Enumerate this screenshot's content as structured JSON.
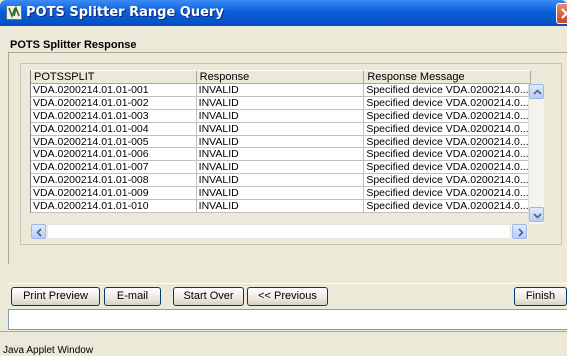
{
  "window": {
    "title": "POTS Splitter Range Query"
  },
  "section": {
    "title": "POTS Splitter Response"
  },
  "table": {
    "columns": [
      "POTSSPLIT",
      "Response",
      "Response Message"
    ],
    "rows": [
      [
        "VDA.0200214.01.01-001",
        "INVALID",
        "Specified device VDA.0200214.0..."
      ],
      [
        "VDA.0200214.01.01-002",
        "INVALID",
        "Specified device VDA.0200214.0..."
      ],
      [
        "VDA.0200214.01.01-003",
        "INVALID",
        "Specified device VDA.0200214.0..."
      ],
      [
        "VDA.0200214.01.01-004",
        "INVALID",
        "Specified device VDA.0200214.0..."
      ],
      [
        "VDA.0200214.01.01-005",
        "INVALID",
        "Specified device VDA.0200214.0..."
      ],
      [
        "VDA.0200214.01.01-006",
        "INVALID",
        "Specified device VDA.0200214.0..."
      ],
      [
        "VDA.0200214.01.01-007",
        "INVALID",
        "Specified device VDA.0200214.0..."
      ],
      [
        "VDA.0200214.01.01-008",
        "INVALID",
        "Specified device VDA.0200214.0..."
      ],
      [
        "VDA.0200214.01.01-009",
        "INVALID",
        "Specified device VDA.0200214.0..."
      ],
      [
        "VDA.0200214.01.01-010",
        "INVALID",
        "Specified device VDA.0200214.0..."
      ]
    ]
  },
  "buttons": {
    "print_preview": "Print Preview",
    "email": "E-mail",
    "start_over": "Start Over",
    "previous": "<< Previous",
    "finish": "Finish"
  },
  "footer": {
    "text": "Java Applet Window"
  },
  "icons": {
    "app": "java-applet-icon",
    "close": "close-icon",
    "scroll_up": "arrow-up-icon",
    "scroll_down": "arrow-down-icon",
    "scroll_left": "arrow-left-icon",
    "scroll_right": "arrow-right-icon"
  },
  "colors": {
    "titlebar": "#0a5fd8",
    "window_bg": "#ece9d8",
    "button_border": "#003c74"
  }
}
